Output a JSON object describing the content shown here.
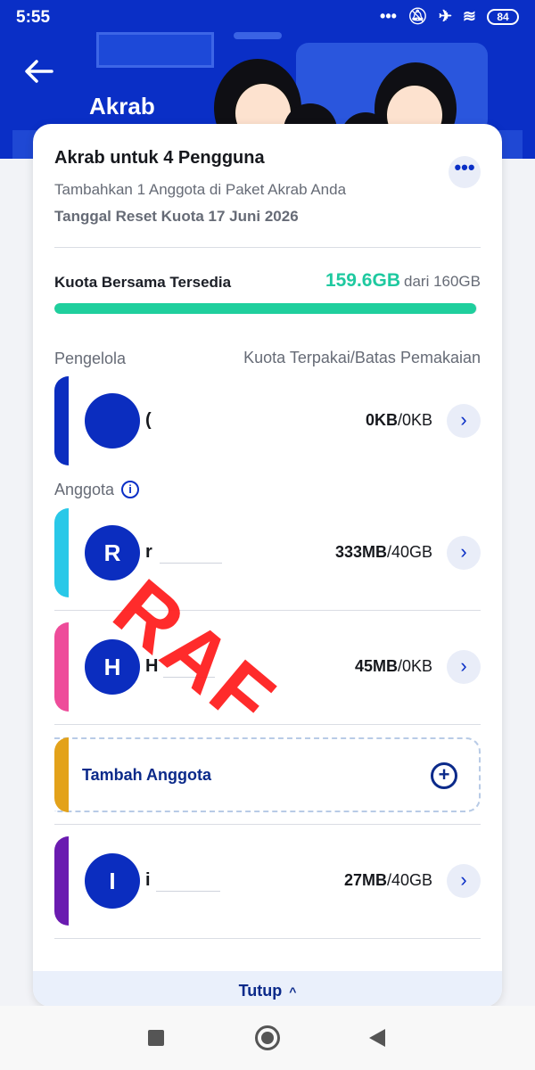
{
  "status_bar": {
    "time": "5:55",
    "icons": [
      "more-dots",
      "mute-icon",
      "airplane-icon",
      "wifi-icon"
    ],
    "battery": "84"
  },
  "header": {
    "title": "Akrab"
  },
  "package": {
    "title": "Akrab untuk 4 Pengguna",
    "subtitle": "Tambahkan 1 Anggota di Paket Akrab Anda",
    "reset_date": "Tanggal Reset Kuota 17 Juni 2026",
    "more_label": "•••"
  },
  "quota": {
    "label": "Kuota Bersama Tersedia",
    "available": "159.6GB",
    "total_text": "dari 160GB",
    "fill_fraction": 0.9975
  },
  "sections": {
    "manager_label": "Pengelola",
    "usage_header": "Kuota Terpakai/Batas Pemakaian",
    "members_label": "Anggota",
    "info_icon": "i"
  },
  "manager": {
    "initial": "",
    "name": "(",
    "used": "0KB",
    "limit": "/0KB",
    "accent": "#0b2dbf"
  },
  "members": [
    {
      "initial": "R",
      "name": "r",
      "used": "333MB",
      "limit": "/40GB",
      "accent": "#29c8e8"
    },
    {
      "initial": "H",
      "name": "H",
      "used": "45MB",
      "limit": "/0KB",
      "accent": "#ee4c9a"
    },
    {
      "initial": "I",
      "name": "i",
      "used": "27MB",
      "limit": "/40GB",
      "accent": "#6a1bb0"
    }
  ],
  "add_member": {
    "label": "Tambah Anggota",
    "icon": "+",
    "accent": "#e3a21a"
  },
  "watermark": "RAF",
  "footer": {
    "close_label": "Tutup",
    "caret": "^"
  },
  "chevron": "›",
  "colors": {
    "brand_blue": "#0a2fc6",
    "quota_green": "#1fcf9d"
  }
}
